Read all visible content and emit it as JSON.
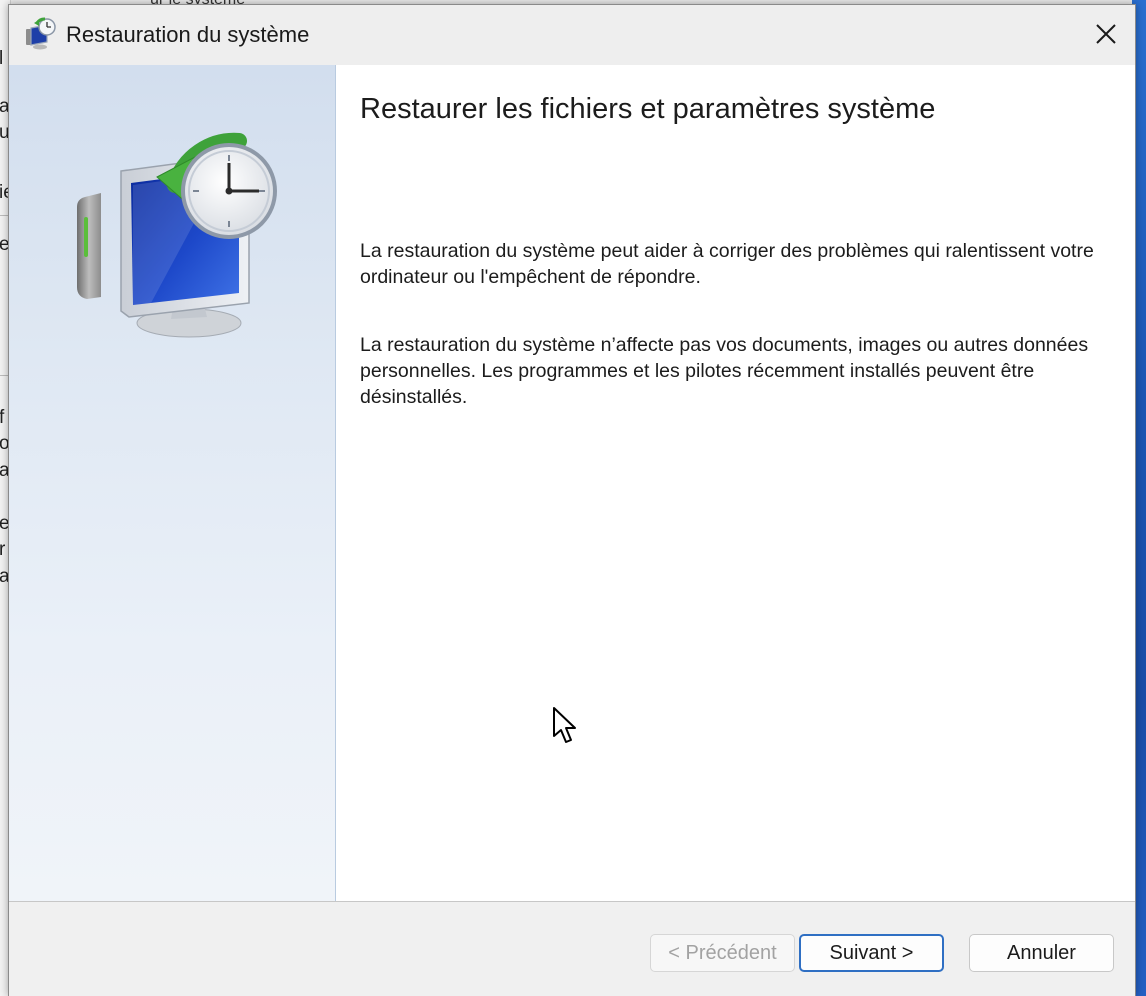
{
  "background": {
    "top_peek_text": "ur le système",
    "left_fragments": [
      "l",
      "a",
      "u",
      "ie",
      "e",
      "f",
      "o",
      "a",
      "e",
      "r",
      "a"
    ]
  },
  "dialog": {
    "title": "Restauration du système",
    "icons": {
      "title": "system-restore-icon",
      "close": "close-icon",
      "hero": "system-restore-monitor-clock-icon"
    },
    "heading": "Restaurer les fichiers et paramètres système",
    "paragraphs": [
      "La restauration du système peut aider à corriger des problèmes qui ralentissent votre ordinateur ou l'empêchent de répondre.",
      "La restauration du système n’affecte pas vos documents, images ou autres données personnelles. Les programmes et les pilotes récemment installés peuvent être désinstallés."
    ],
    "buttons": {
      "previous": "< Précédent",
      "next": "Suivant >",
      "cancel": "Annuler"
    },
    "states": {
      "previous_enabled": false,
      "default_button": "next"
    }
  },
  "colors": {
    "accent": "#2f6fc3",
    "sidebar_top": "#d2deee",
    "sidebar_bottom": "#f0f4f9",
    "disabled_text": "#a2a2a2"
  }
}
